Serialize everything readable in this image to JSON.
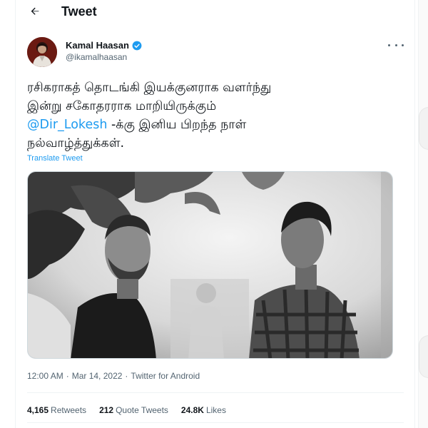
{
  "header": {
    "title": "Tweet",
    "back_icon": "arrow-left-icon"
  },
  "author": {
    "name": "Kamal Haasan",
    "handle": "@ikamalhaasan",
    "verified_color": "#1d9bf0"
  },
  "tweet": {
    "lines": [
      "ரசிகராகத் தொடங்கி இயக்குனராக வளர்ந்து",
      "இன்று சகோதரராக மாறியிருக்கும்"
    ],
    "mention": "@Dir_Lokesh",
    "mention_suffix": " -க்கு இனிய பிறந்த நாள்",
    "last_line": "நல்வாழ்த்துக்கள்.",
    "translate_label": "Translate Tweet"
  },
  "meta": {
    "time": "12:00 AM",
    "separator": "·",
    "date": "Mar 14, 2022",
    "client": "Twitter for Android"
  },
  "stats": {
    "retweets_count": "4,165",
    "retweets_label": "Retweets",
    "quotes_count": "212",
    "quotes_label": "Quote Tweets",
    "likes_count": "24.8K",
    "likes_label": "Likes"
  },
  "colors": {
    "accent": "#1d9bf0",
    "text": "#0f1419",
    "secondary": "#536471"
  }
}
